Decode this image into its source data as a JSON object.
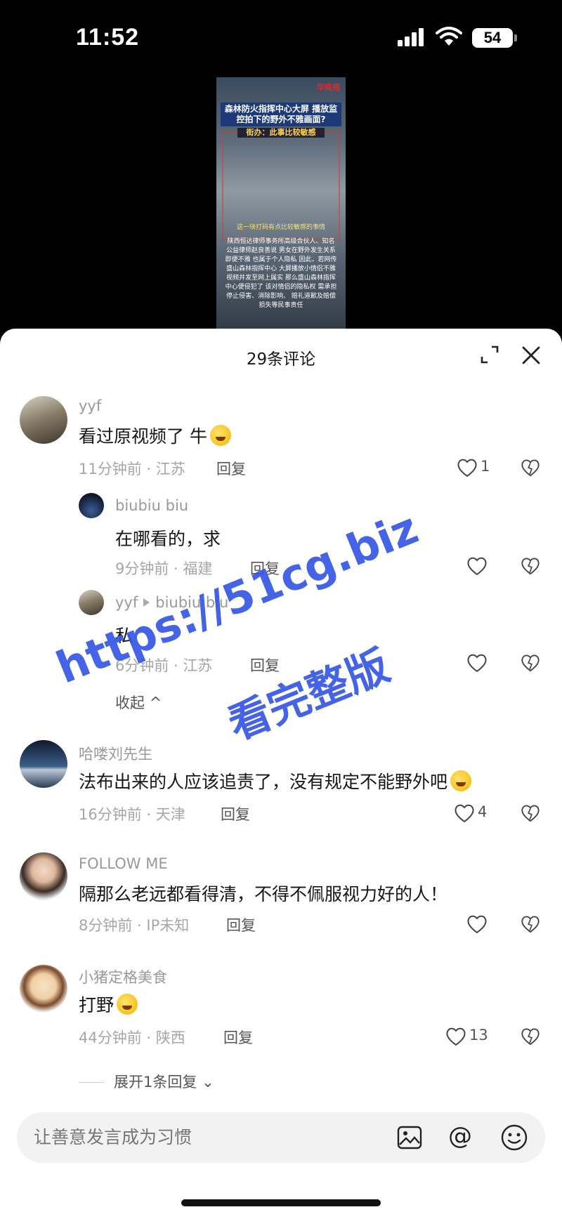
{
  "status_bar": {
    "time": "11:52",
    "battery": "54"
  },
  "video": {
    "logo": "华商报",
    "headline": "森林防火指挥中心大屏 播放监控拍下的野外不雅画面?",
    "subhead": "街办：此事比较敏感",
    "caption": "这一块打码有点比较敏感的事情",
    "body": "陕西恒达律师事务所高级合伙人、知名公益律师赵良善说 男女在野外发生关系即便不雅 也属于个人隐私 因此，若网传盛山森林指挥中心 大屏播放小情侣不雅视频并发至网上属实 那么盛山森林指挥中心便侵犯了 该对情侣的隐私权 需承担停止侵害、消除影响、 赔礼道歉及赔偿损失等民事责任"
  },
  "sheet": {
    "title": "29条评论"
  },
  "comments": [
    {
      "user": "yyf",
      "text": "看过原视频了 牛",
      "meta": "11分钟前 · 江苏",
      "reply_label": "回复",
      "likes": "1"
    },
    {
      "user": "biubiu biu",
      "text": "在哪看的，求",
      "meta": "9分钟前 · 福建",
      "reply_label": "回复",
      "likes": ""
    },
    {
      "user": "yyf",
      "reply_to": "biubiu biu",
      "text": "私",
      "meta": "6分钟前 · 江苏",
      "reply_label": "回复",
      "likes": ""
    },
    {
      "user": "哈喽刘先生",
      "text": "法布出来的人应该追责了，没有规定不能野外吧",
      "meta": "16分钟前 · 天津",
      "reply_label": "回复",
      "likes": "4"
    },
    {
      "user": "FOLLOW ME",
      "text": "隔那么老远都看得清，不得不佩服视力好的人！",
      "meta": "8分钟前 · IP未知",
      "reply_label": "回复",
      "likes": ""
    },
    {
      "user": "小猪定格美食",
      "text": "打野",
      "meta": "44分钟前 · 陕西",
      "reply_label": "回复",
      "likes": "13"
    }
  ],
  "collapse_label": "收起",
  "expand_label": "展开1条回复",
  "input": {
    "placeholder": "让善意发言成为习惯"
  },
  "watermark": {
    "line1": "https://51cg.biz",
    "line2": "看完整版"
  },
  "colors": {
    "sheet_bg": "#ffffff",
    "watermark": "#3556e6",
    "input_bg": "#f2f2f2"
  },
  "icons": [
    "signal-icon",
    "wifi-icon",
    "battery-icon",
    "expand-icon",
    "close-icon",
    "heart-icon",
    "dislike-heart-icon",
    "image-icon",
    "at-icon",
    "smile-icon",
    "chevron-down-icon",
    "chevron-up-icon"
  ]
}
